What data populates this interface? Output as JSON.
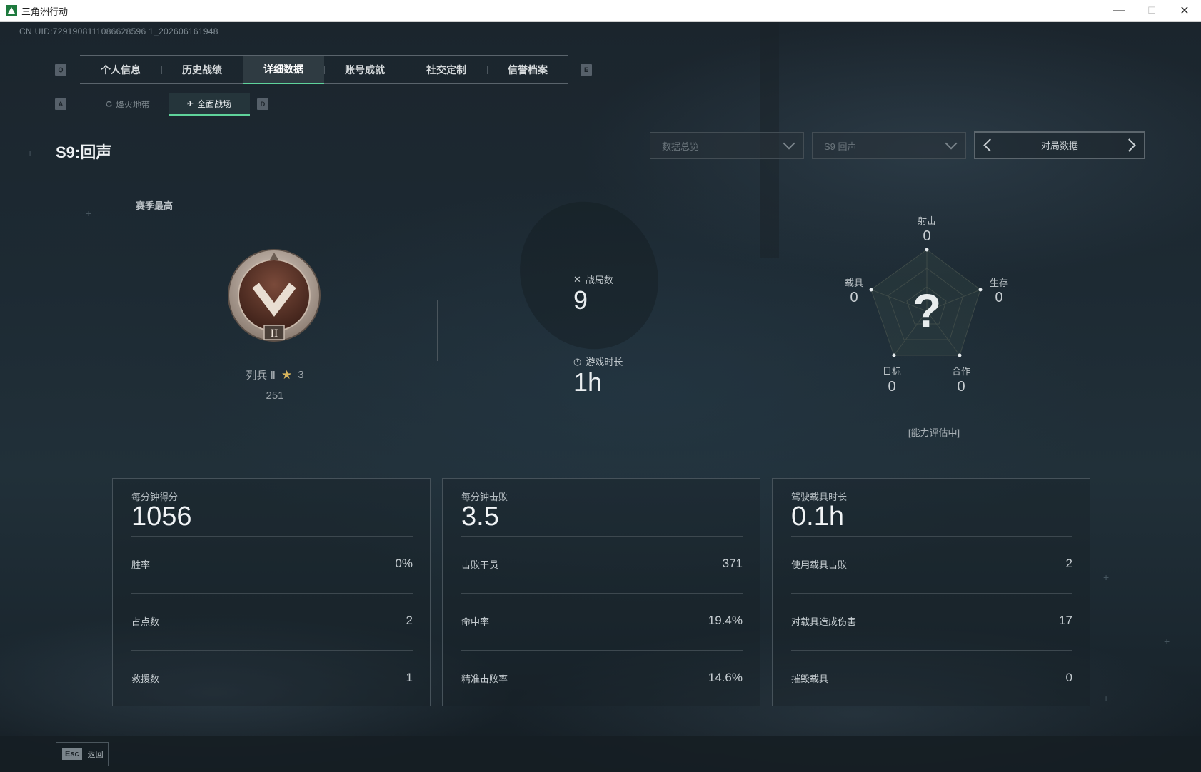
{
  "window": {
    "title": "三角洲行动",
    "minimize": "—",
    "maximize": "☐",
    "close": "✕"
  },
  "uid": "CN UID:7291908111086628596 1_202606161948",
  "tabs": {
    "prev_key": "Q",
    "next_key": "E",
    "items": [
      {
        "label": "个人信息"
      },
      {
        "label": "历史战绩"
      },
      {
        "label": "详细数据",
        "active": true
      },
      {
        "label": "账号成就"
      },
      {
        "label": "社交定制"
      },
      {
        "label": "信誉档案"
      }
    ]
  },
  "subtabs": {
    "prev_key": "A",
    "next_key": "D",
    "items": [
      {
        "label": "烽火地带",
        "icon": "extraction-icon"
      },
      {
        "label": "全面战场",
        "icon": "warfare-icon",
        "active": true
      }
    ]
  },
  "season": {
    "title": "S9:回声"
  },
  "filters": {
    "dropdown1": "数据总览",
    "dropdown2": "S9 回声",
    "pager_label": "对局数据"
  },
  "rank": {
    "season_best_label": "赛季最高",
    "tier_numeral": "II",
    "name": "列兵 Ⅱ",
    "stars": "3",
    "points": "251"
  },
  "center_stats": {
    "matches_label": "战局数",
    "matches_value": "9",
    "playtime_label": "游戏时长",
    "playtime_value": "1h"
  },
  "radar": {
    "center_mark": "?",
    "axes": [
      {
        "label": "射击",
        "value": "0"
      },
      {
        "label": "生存",
        "value": "0"
      },
      {
        "label": "合作",
        "value": "0"
      },
      {
        "label": "目标",
        "value": "0"
      },
      {
        "label": "载具",
        "value": "0"
      }
    ],
    "status": "[能力评估中]"
  },
  "panels": [
    {
      "title": "每分钟得分",
      "value": "1056",
      "rows": [
        {
          "label": "胜率",
          "value": "0%"
        },
        {
          "label": "占点数",
          "value": "2"
        },
        {
          "label": "救援数",
          "value": "1"
        }
      ]
    },
    {
      "title": "每分钟击败",
      "value": "3.5",
      "rows": [
        {
          "label": "击败干员",
          "value": "371"
        },
        {
          "label": "命中率",
          "value": "19.4%"
        },
        {
          "label": "精准击败率",
          "value": "14.6%"
        }
      ]
    },
    {
      "title": "驾驶载具时长",
      "value": "0.1h",
      "rows": [
        {
          "label": "使用载具击败",
          "value": "2"
        },
        {
          "label": "对载具造成伤害",
          "value": "17"
        },
        {
          "label": "摧毁载具",
          "value": "0"
        }
      ]
    }
  ],
  "footer": {
    "esc_key": "Esc",
    "back_label": "返回"
  },
  "colors": {
    "accent": "#5fd39b",
    "background": "#1d2a33",
    "star": "#d9b65d"
  }
}
